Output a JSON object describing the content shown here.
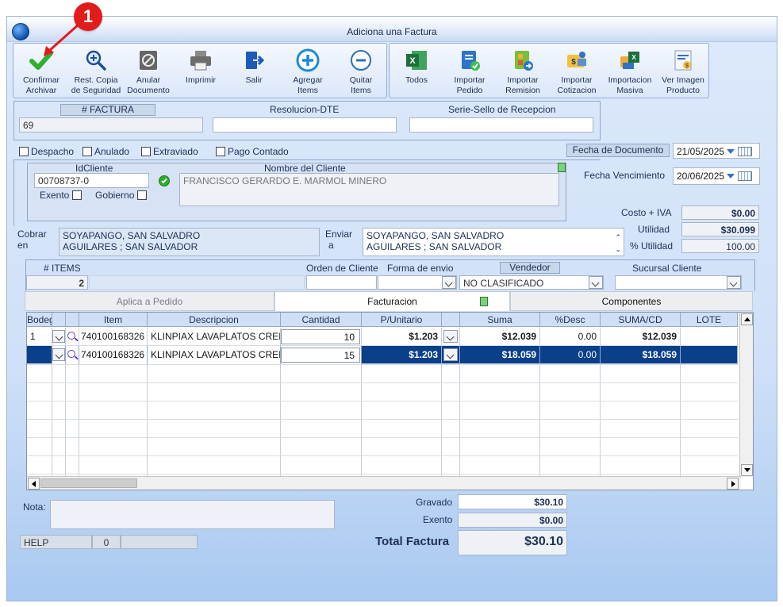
{
  "window": {
    "title": "Adiciona una Factura"
  },
  "callout": {
    "number": "1"
  },
  "toolbar": {
    "left": [
      {
        "id": "confirmar",
        "line1": "Confirmar",
        "line2": "Archivar",
        "icon": "checkmark-icon"
      },
      {
        "id": "restcopia",
        "line1": "Rest. Copia",
        "line2": "de Seguridad",
        "icon": "zoom-in-icon"
      },
      {
        "id": "anular",
        "line1": "Anular",
        "line2": "Documento",
        "icon": "void-document-icon"
      },
      {
        "id": "imprimir",
        "line1": "Imprimir",
        "line2": "",
        "icon": "printer-icon"
      },
      {
        "id": "salir",
        "line1": "Salir",
        "line2": "",
        "icon": "exit-icon"
      },
      {
        "id": "agregar",
        "line1": "Agregar",
        "line2": "Items",
        "icon": "plus-circle-icon"
      },
      {
        "id": "quitar",
        "line1": "Quitar",
        "line2": "Items",
        "icon": "minus-circle-icon"
      }
    ],
    "right": [
      {
        "id": "todos",
        "line1": "Todos",
        "line2": "",
        "icon": "excel-icon"
      },
      {
        "id": "impedido",
        "line1": "Importar",
        "line2": "Pedido",
        "icon": "import-order-icon"
      },
      {
        "id": "imremision",
        "line1": "Importar",
        "line2": "Remision",
        "icon": "import-remission-icon"
      },
      {
        "id": "imcotizacion",
        "line1": "Importar",
        "line2": "Cotizacion",
        "icon": "import-quote-icon"
      },
      {
        "id": "immasiva",
        "line1": "Importacion",
        "line2": "Masiva",
        "icon": "bulk-import-icon"
      },
      {
        "id": "verimagen",
        "line1": "Ver Imagen",
        "line2": "Producto",
        "icon": "product-image-icon"
      }
    ]
  },
  "factura": {
    "numero_label": "# FACTURA",
    "numero": "69",
    "resolucion_label": "Resolucion-DTE",
    "resolucion": "",
    "serie_label": "Serie-Sello de Recepcion",
    "serie": ""
  },
  "flags": {
    "despacho": "Despacho",
    "anulado": "Anulado",
    "extraviado": "Extraviado",
    "pago_contado": "Pago Contado"
  },
  "fechas": {
    "documento_label": "Fecha de  Documento",
    "documento": "21/05/2025",
    "vencimiento_label": "Fecha Vencimiento",
    "vencimiento": "20/06/2025"
  },
  "cliente": {
    "id_label": "IdCliente",
    "id": "00708737-0",
    "nombre_label": "Nombre del Cliente",
    "nombre": "FRANCISCO GERARDO E. MARMOL MINERO",
    "exento_label": "Exento",
    "gobierno_label": "Gobierno"
  },
  "resumen": {
    "costo_label": "Costo + IVA",
    "costo": "$0.00",
    "utilidad_label": "Utilidad",
    "utilidad": "$30.099",
    "pct_label": "% Utilidad",
    "pct": "100.00"
  },
  "cobrar": {
    "label1": "Cobrar",
    "label2": "en",
    "line1": "SOYAPANGO, SAN SALVADRO",
    "line2": "AGUILARES ; SAN SALVADOR"
  },
  "enviar": {
    "label1": "Enviar",
    "label2": "a",
    "line1": "SOYAPANGO, SAN SALVADRO",
    "line2": "AGUILARES ; SAN SALVADOR"
  },
  "items_bar": {
    "items_label": "# ITEMS",
    "items": "2",
    "orden_label": "Orden de Cliente",
    "orden": "",
    "forma_label": "Forma de envio",
    "forma": "",
    "vendedor_label": "Vendedor",
    "vendedor": "NO CLASIFICADO",
    "sucursal_label": "Sucursal Cliente",
    "sucursal": ""
  },
  "tabs": {
    "aplica": "Aplica a Pedido",
    "facturacion": "Facturacion",
    "componentes": "Componentes"
  },
  "grid": {
    "headers": {
      "bodega": "Bodega",
      "item": "Item",
      "descripcion": "Descripcion",
      "cantidad": "Cantidad",
      "punitario": "P/Unitario",
      "suma": "Suma",
      "pdesc": "%Desc",
      "sumacd": "SUMA/CD",
      "lote": "LOTE"
    },
    "rows": [
      {
        "bodega": "1",
        "item": "740100168326",
        "descripcion": "KLINPIAX LAVAPLATOS CREI",
        "cantidad": "10",
        "punitario": "$1.203",
        "suma": "$12.039",
        "pdesc": "0.00",
        "sumacd": "$12.039",
        "lote": ""
      },
      {
        "bodega": "",
        "item": "740100168326",
        "descripcion": "KLINPIAX LAVAPLATOS CREI",
        "cantidad": "15",
        "punitario": "$1.203",
        "suma": "$18.059",
        "pdesc": "0.00",
        "sumacd": "$18.059",
        "lote": ""
      }
    ]
  },
  "footer": {
    "nota_label": "Nota:",
    "nota": "",
    "help_label": "HELP",
    "help_count": "0",
    "help_extra": "",
    "gravado_label": "Gravado",
    "gravado": "$30.10",
    "exento_label": "Exento",
    "exento": "$0.00",
    "total_label": "Total Factura",
    "total": "$30.10"
  }
}
